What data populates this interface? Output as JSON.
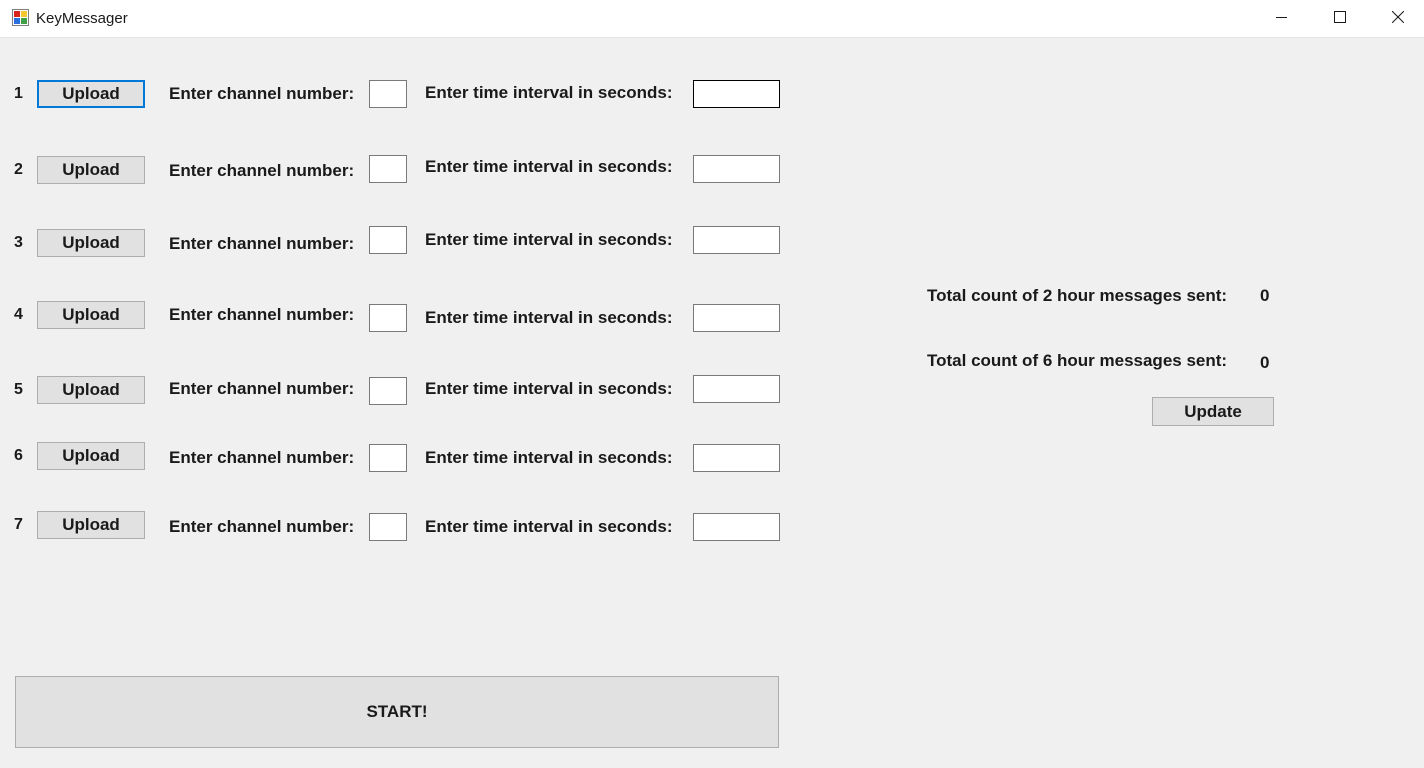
{
  "window": {
    "title": "KeyMessager",
    "icon": "app-window-icon",
    "controls": [
      "minimize-icon",
      "maximize-icon",
      "close-icon"
    ]
  },
  "rows": [
    {
      "number": "1",
      "upload_label": "Upload",
      "channel_label": "Enter channel number:",
      "channel_value": "",
      "interval_label": "Enter time interval in seconds:",
      "interval_value": ""
    },
    {
      "number": "2",
      "upload_label": "Upload",
      "channel_label": "Enter channel number:",
      "channel_value": "",
      "interval_label": "Enter time interval in seconds:",
      "interval_value": ""
    },
    {
      "number": "3",
      "upload_label": "Upload",
      "channel_label": "Enter channel number:",
      "channel_value": "",
      "interval_label": "Enter time interval in seconds:",
      "interval_value": ""
    },
    {
      "number": "4",
      "upload_label": "Upload",
      "channel_label": "Enter channel number:",
      "channel_value": "",
      "interval_label": "Enter time interval in seconds:",
      "interval_value": ""
    },
    {
      "number": "5",
      "upload_label": "Upload",
      "channel_label": "Enter channel number:",
      "channel_value": "",
      "interval_label": "Enter time interval in seconds:",
      "interval_value": ""
    },
    {
      "number": "6",
      "upload_label": "Upload",
      "channel_label": "Enter channel number:",
      "channel_value": "",
      "interval_label": "Enter time interval in seconds:",
      "interval_value": ""
    },
    {
      "number": "7",
      "upload_label": "Upload",
      "channel_label": "Enter channel number:",
      "channel_value": "",
      "interval_label": "Enter time interval in seconds:",
      "interval_value": ""
    }
  ],
  "stats": {
    "two_hour_label": "Total count of 2 hour messages sent:",
    "two_hour_value": "0",
    "six_hour_label": "Total count of 6 hour messages sent:",
    "six_hour_value": "0",
    "update_label": "Update"
  },
  "start_label": "START!",
  "colors": {
    "background": "#f0f0f0",
    "button": "#e1e1e1",
    "focus_border": "#0078d7"
  }
}
